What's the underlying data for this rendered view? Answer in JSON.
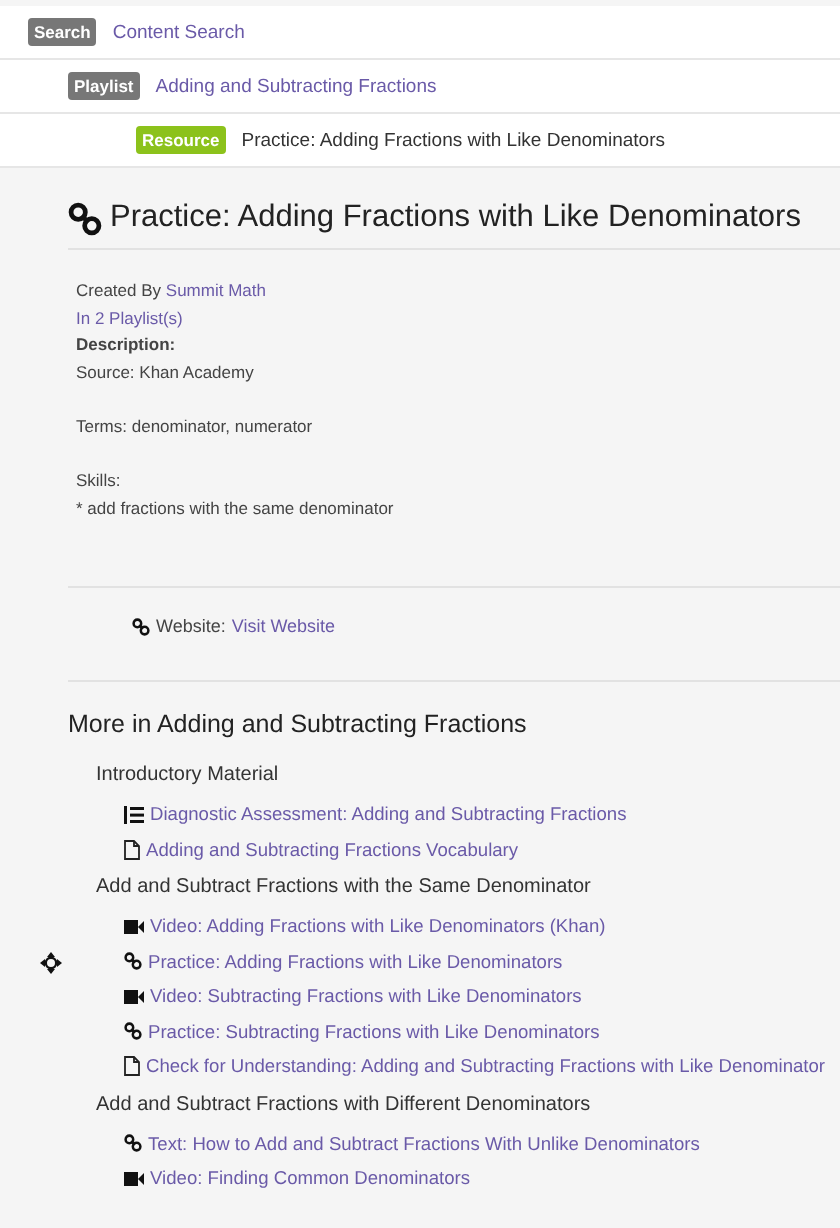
{
  "breadcrumbs": [
    {
      "badge": "Search",
      "kind": "search",
      "label": "Content Search"
    },
    {
      "badge": "Playlist",
      "kind": "playlist",
      "label": "Adding and Subtracting Fractions"
    },
    {
      "badge": "Resource",
      "kind": "resource",
      "label": "Practice: Adding Fractions with Like Denominators"
    }
  ],
  "title": "Practice: Adding Fractions with Like Denominators",
  "created_by_label": "Created By",
  "created_by": "Summit Math",
  "playlists_link": "In 2 Playlist(s)",
  "description_label": "Description:",
  "source": "Source: Khan Academy",
  "terms": "Terms: denominator, numerator",
  "skills_label": "Skills:",
  "skills": "* add fractions with the same denominator",
  "website_label": "Website:",
  "website_link": "Visit Website",
  "more_heading": "More in Adding and Subtracting Fractions",
  "groups": [
    {
      "title": "Introductory Material",
      "items": [
        {
          "kind": "list",
          "label": "Diagnostic Assessment: Adding and Subtracting Fractions"
        },
        {
          "kind": "document",
          "label": "Adding and Subtracting Fractions Vocabulary"
        }
      ]
    },
    {
      "title": "Add and Subtract Fractions with the Same Denominator",
      "items": [
        {
          "kind": "video",
          "label": "Video: Adding Fractions with Like Denominators (Khan)"
        },
        {
          "kind": "link",
          "label": "Practice: Adding Fractions with Like Denominators",
          "handle": true
        },
        {
          "kind": "video",
          "label": "Video: Subtracting Fractions with Like Denominators"
        },
        {
          "kind": "link",
          "label": "Practice: Subtracting Fractions with Like Denominators"
        },
        {
          "kind": "document",
          "label": "Check for Understanding: Adding and Subtracting Fractions with Like Denominator"
        }
      ]
    },
    {
      "title": "Add and Subtract Fractions with Different Denominators",
      "items": [
        {
          "kind": "link",
          "label": "Text: How to Add and Subtract Fractions With Unlike Denominators"
        },
        {
          "kind": "video",
          "label": "Video: Finding Common Denominators"
        }
      ]
    }
  ]
}
